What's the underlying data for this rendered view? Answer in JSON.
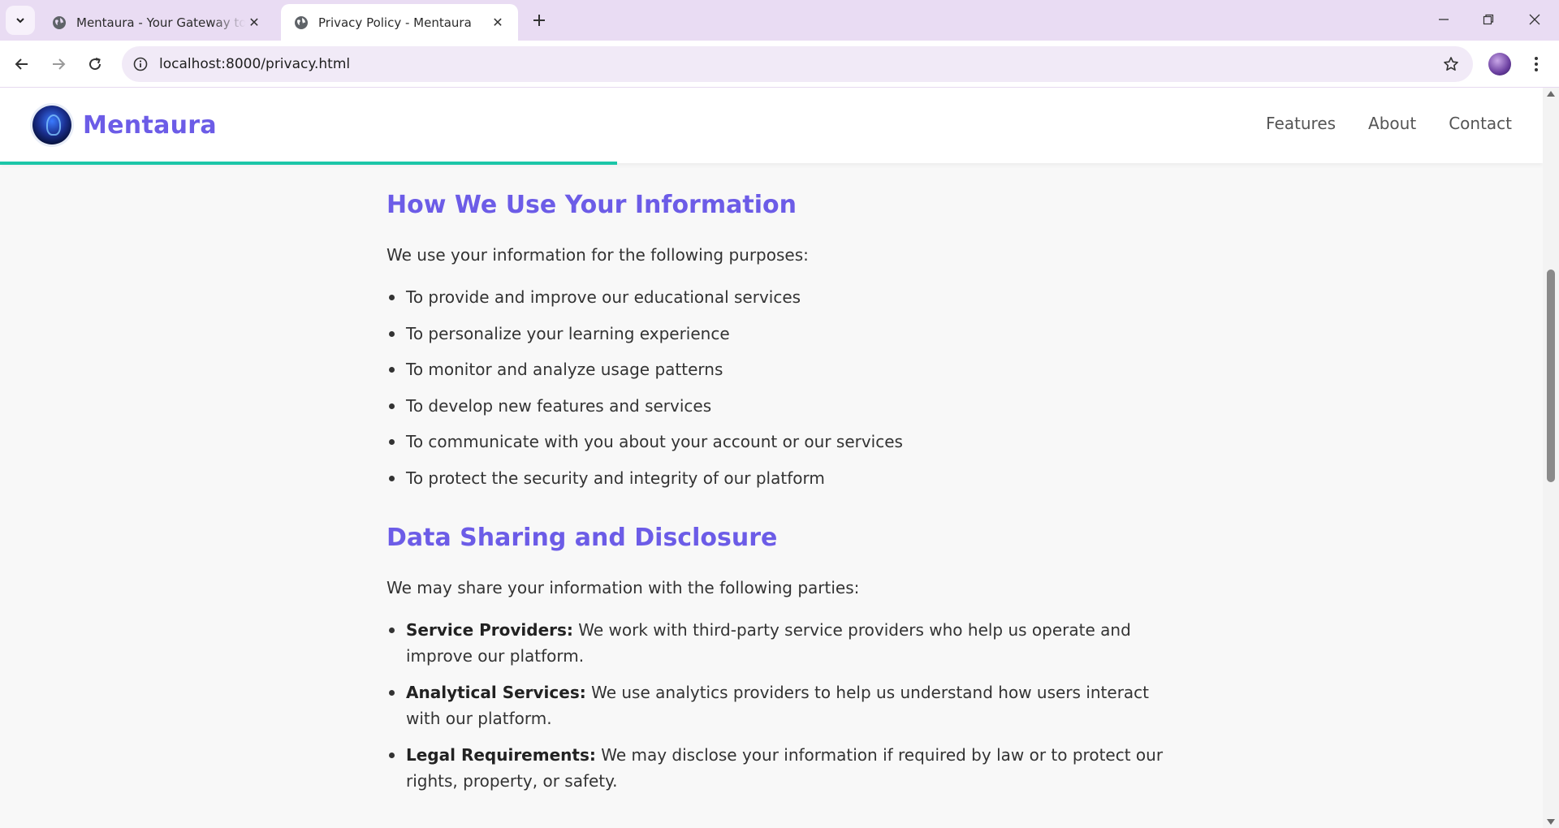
{
  "browser": {
    "tabs": [
      {
        "title": "Mentaura - Your Gateway to Learning",
        "active": false
      },
      {
        "title": "Privacy Policy - Mentaura",
        "active": true
      }
    ],
    "url": "localhost:8000/privacy.html"
  },
  "site": {
    "brand_name": "Mentaura",
    "nav": [
      "Features",
      "About",
      "Contact"
    ],
    "reading_progress_percent": 40
  },
  "sections": {
    "use": {
      "title": "How We Use Your Information",
      "intro": "We use your information for the following purposes:",
      "items": [
        "To provide and improve our educational services",
        "To personalize your learning experience",
        "To monitor and analyze usage patterns",
        "To develop new features and services",
        "To communicate with you about your account or our services",
        "To protect the security and integrity of our platform"
      ]
    },
    "sharing": {
      "title": "Data Sharing and Disclosure",
      "intro": "We may share your information with the following parties:",
      "items": [
        {
          "label": "Service Providers:",
          "text": " We work with third-party service providers who help us operate and improve our platform."
        },
        {
          "label": "Analytical Services:",
          "text": " We use analytics providers to help us understand how users interact with our platform."
        },
        {
          "label": "Legal Requirements:",
          "text": " We may disclose your information if required by law or to protect our rights, property, or safety."
        }
      ]
    }
  },
  "colors": {
    "accent": "#6c5ce7",
    "progress": "#1cc6a8",
    "tabbar": "#e9dcf3"
  }
}
